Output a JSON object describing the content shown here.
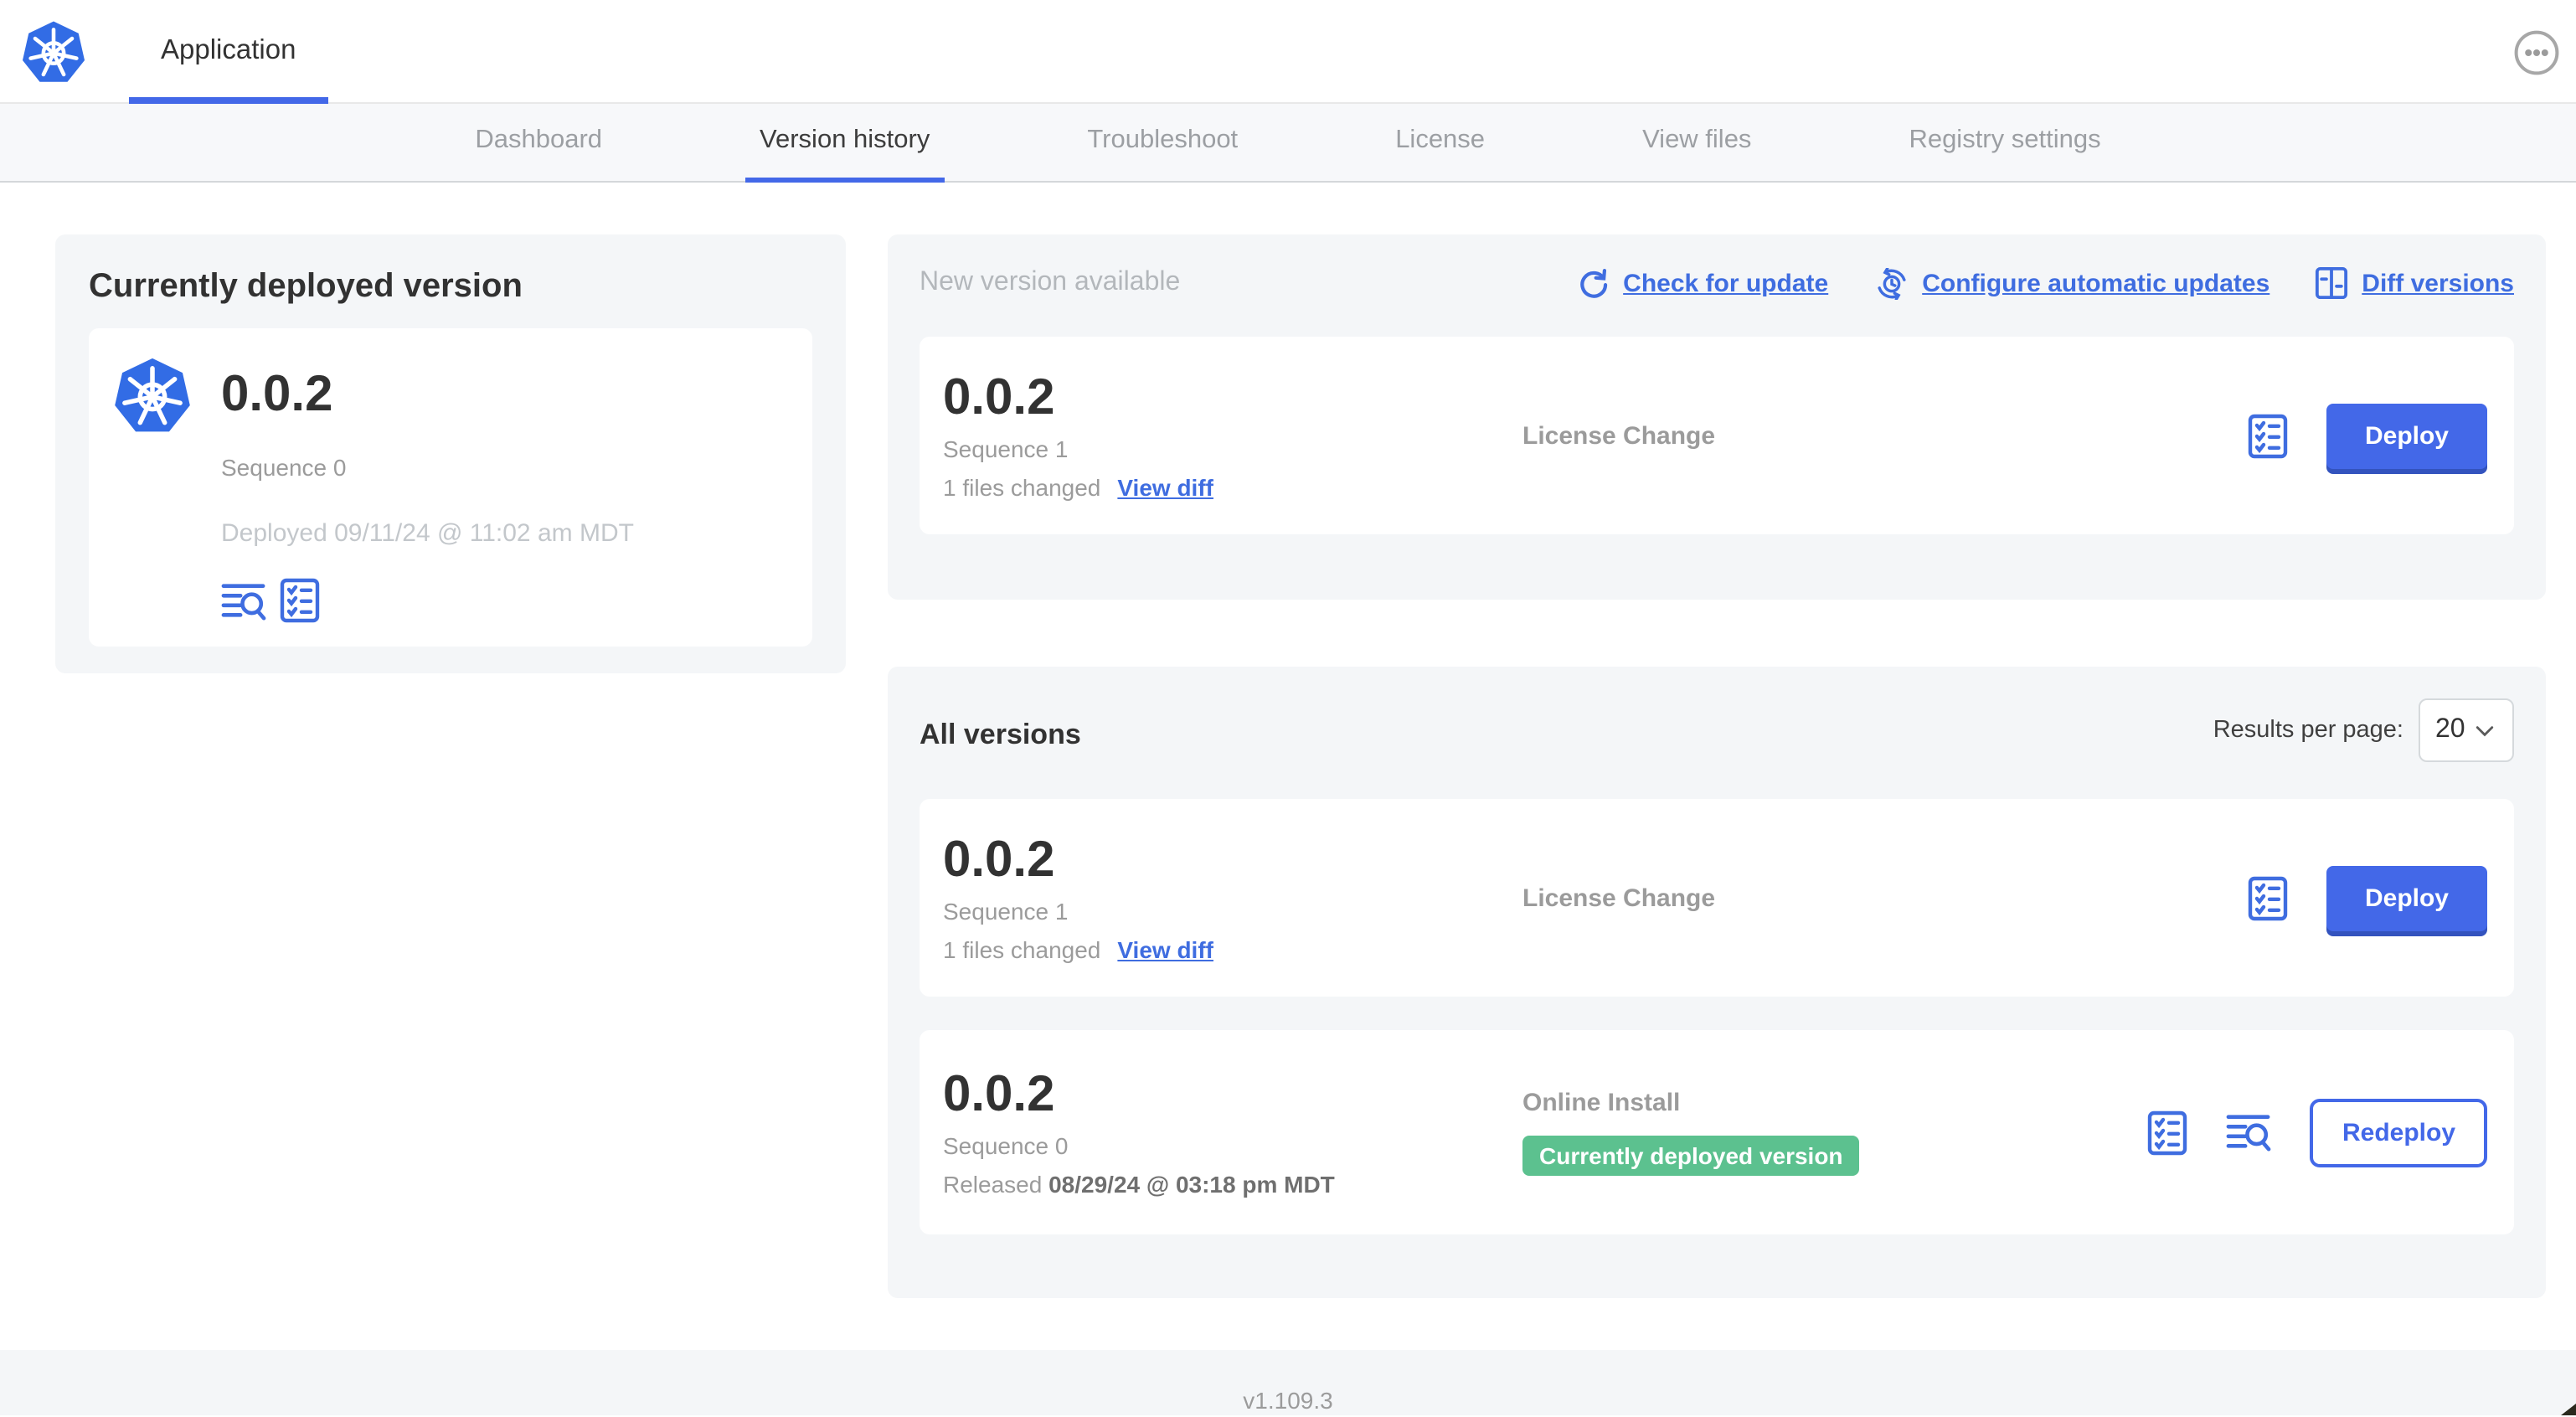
{
  "header": {
    "app_title": "Application"
  },
  "nav": {
    "tabs": [
      {
        "label": "Dashboard",
        "active": false
      },
      {
        "label": "Version history",
        "active": true
      },
      {
        "label": "Troubleshoot",
        "active": false
      },
      {
        "label": "License",
        "active": false
      },
      {
        "label": "View files",
        "active": false
      },
      {
        "label": "Registry settings",
        "active": false
      }
    ]
  },
  "current_version": {
    "panel_title": "Currently deployed version",
    "version": "0.0.2",
    "sequence": "Sequence 0",
    "deployed": "Deployed 09/11/24 @ 11:02 am MDT"
  },
  "new_version": {
    "panel_title": "New version available",
    "actions": {
      "check_for_update": "Check for update",
      "configure_automatic_updates": "Configure automatic updates",
      "diff_versions": "Diff versions"
    },
    "card": {
      "version": "0.0.2",
      "sequence": "Sequence 1",
      "files_changed": "1 files changed",
      "view_diff": "View diff",
      "source": "License Change",
      "deploy_label": "Deploy"
    }
  },
  "all_versions": {
    "title": "All versions",
    "results_per_page_label": "Results per page:",
    "results_per_page_value": "20",
    "rows": [
      {
        "version": "0.0.2",
        "sequence": "Sequence 1",
        "files_changed": "1 files changed",
        "view_diff": "View diff",
        "source": "License Change",
        "action_label": "Deploy"
      },
      {
        "version": "0.0.2",
        "sequence": "Sequence 0",
        "released_label": "Released",
        "released_date": "08/29/24 @ 03:18 pm MDT",
        "source": "Online Install",
        "badge": "Currently deployed version",
        "action_label": "Redeploy"
      }
    ]
  },
  "footer": {
    "version": "v1.109.3"
  },
  "colors": {
    "primary_blue": "#4368e8",
    "link_blue": "#3f6de0",
    "kubernetes_blue": "#326ce5",
    "badge_green": "#5cc18f",
    "panel_gray": "#f4f6f8",
    "text_dark": "#323232",
    "text_gray": "#9b9b9b",
    "text_light_gray": "#c3c7cb"
  }
}
